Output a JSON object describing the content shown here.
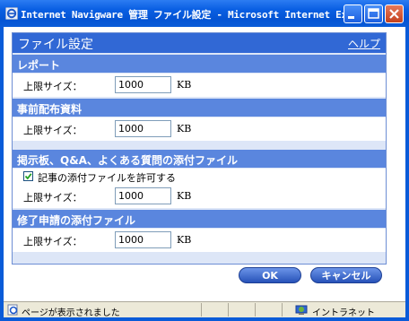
{
  "window": {
    "title": "Internet Navigware 管理 ファイル設定 - Microsoft Internet Explor..."
  },
  "panel": {
    "title": "ファイル設定",
    "help_link": "ヘルプ"
  },
  "sections": [
    {
      "heading": "レポート",
      "label": "上限サイズ：",
      "value": "1000",
      "unit": "KB"
    },
    {
      "heading": "事前配布資料",
      "label": "上限サイズ：",
      "value": "1000",
      "unit": "KB"
    },
    {
      "heading": "掲示板、Q&A、よくある質問の添付ファイル",
      "checkbox_label": "記事の添付ファイルを許可する",
      "checkbox_checked": true,
      "label": "上限サイズ：",
      "value": "1000",
      "unit": "KB"
    },
    {
      "heading": "修了申請の添付ファイル",
      "label": "上限サイズ：",
      "value": "1000",
      "unit": "KB"
    }
  ],
  "buttons": {
    "ok": "OK",
    "cancel": "キャンセル"
  },
  "status": {
    "text": "ページが表示されました",
    "zone": "イントラネット"
  },
  "colors": {
    "titlebar": "#0a5bd8",
    "panel_header": "#3168d5",
    "section_header": "#5a86de",
    "panel_bg": "#dde6f7"
  }
}
